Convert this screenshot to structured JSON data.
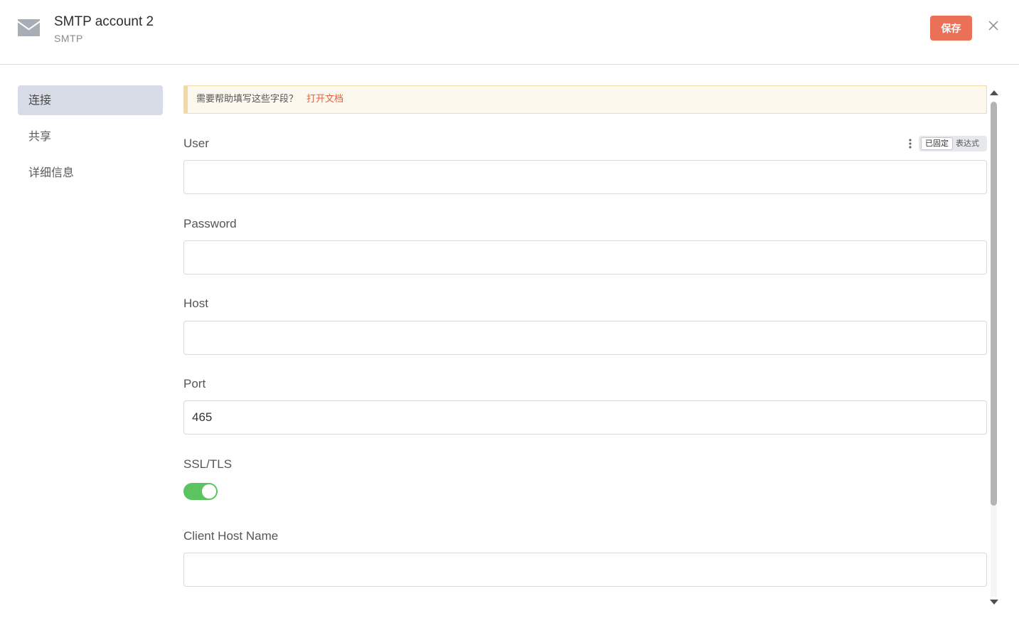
{
  "header": {
    "title": "SMTP account 2",
    "subtitle": "SMTP",
    "save_label": "保存",
    "icon": "envelope-icon"
  },
  "sidebar": {
    "items": [
      {
        "label": "连接",
        "active": true
      },
      {
        "label": "共享",
        "active": false
      },
      {
        "label": "详细信息",
        "active": false
      }
    ]
  },
  "notice": {
    "text": "需要帮助填写这些字段？",
    "link": "打开文档"
  },
  "mode_toggle": {
    "fixed": "已固定",
    "expression": "表达式"
  },
  "fields": {
    "user": {
      "label": "User",
      "value": ""
    },
    "password": {
      "label": "Password",
      "value": ""
    },
    "host": {
      "label": "Host",
      "value": ""
    },
    "port": {
      "label": "Port",
      "value": "465"
    },
    "ssl": {
      "label": "SSL/TLS",
      "enabled": true
    },
    "client_host": {
      "label": "Client Host Name",
      "value": ""
    }
  },
  "colors": {
    "accent": "#ea7058",
    "link": "#e3623f",
    "toggle_on": "#5cc361",
    "sidebar_active": "#d6dbe6"
  }
}
